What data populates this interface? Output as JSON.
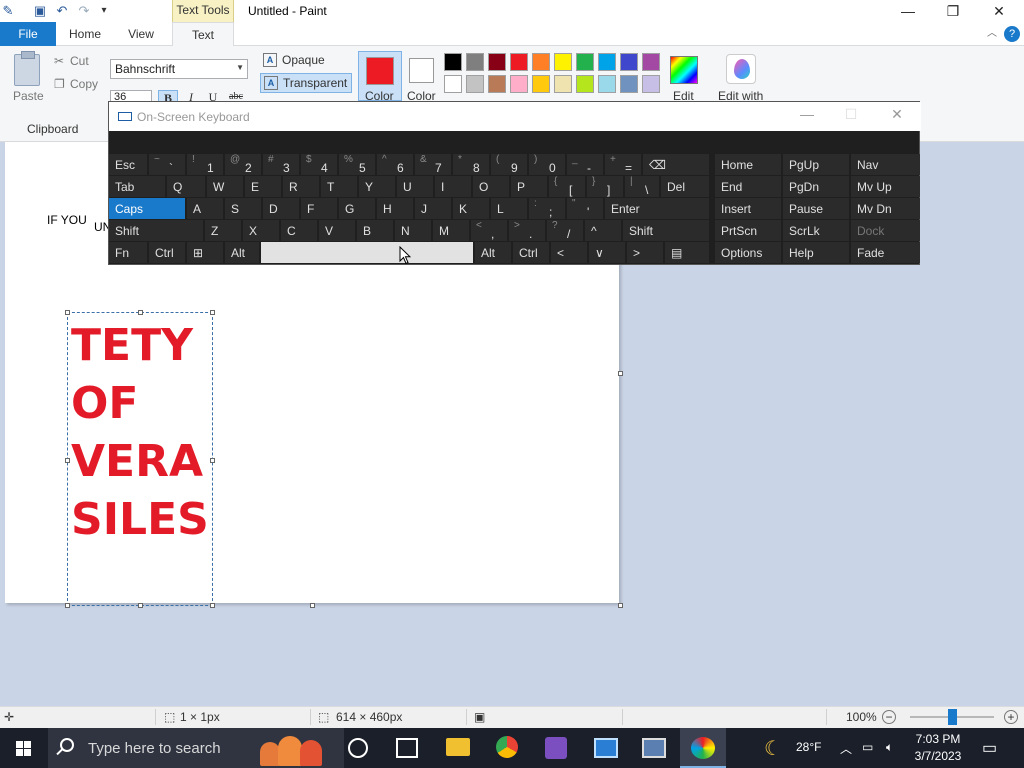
{
  "title_bar": {
    "context_tab": "Text Tools",
    "window_title": "Untitled - Paint",
    "minimize": "—",
    "maximize": "❐",
    "close": "✕"
  },
  "ribbon_tabs": {
    "file": "File",
    "home": "Home",
    "view": "View",
    "text": "Text",
    "help": "?"
  },
  "ribbon": {
    "paste": "Paste",
    "cut": "Cut",
    "copy": "Copy",
    "clipboard_group": "Clipboard",
    "font_name": "Bahnschrift",
    "font_size": "36",
    "bold": "B",
    "italic": "I",
    "underline": "U",
    "strike": "abc",
    "opaque": "Opaque",
    "transparent": "Transparent",
    "color1_label": "Color",
    "color2_label": "Color",
    "edit_colors": "Edit",
    "edit_with": "Edit with",
    "color1": "#ed1c24",
    "color2": "#ffffff",
    "palette_row1": [
      "#000000",
      "#7f7f7f",
      "#880015",
      "#ed1c24",
      "#ff7f27",
      "#fff200",
      "#22b14c",
      "#00a2e8",
      "#3f48cc",
      "#a349a4"
    ],
    "palette_row2": [
      "#ffffff",
      "#c3c3c3",
      "#b97a57",
      "#ffaec9",
      "#ffc90e",
      "#efe4b0",
      "#b5e61d",
      "#99d9ea",
      "#7092be",
      "#c8bfe7"
    ]
  },
  "canvas": {
    "text_if_you": "IF YOU",
    "text_un": "UN",
    "lines": [
      "TETY",
      "OF",
      "VERA",
      "SILES"
    ]
  },
  "osk": {
    "title": "On-Screen Keyboard",
    "rows": [
      [
        {
          "m": "Esc"
        },
        {
          "s": "~",
          "k": "`"
        },
        {
          "s": "!",
          "k": "1"
        },
        {
          "s": "@",
          "k": "2"
        },
        {
          "s": "#",
          "k": "3"
        },
        {
          "s": "$",
          "k": "4"
        },
        {
          "s": "%",
          "k": "5"
        },
        {
          "s": "^",
          "k": "6"
        },
        {
          "s": "&",
          "k": "7"
        },
        {
          "s": "*",
          "k": "8"
        },
        {
          "s": "(",
          "k": "9"
        },
        {
          "s": ")",
          "k": "0"
        },
        {
          "s": "_",
          "k": "-"
        },
        {
          "s": "+",
          "k": "="
        },
        {
          "m": "⌫"
        }
      ],
      [
        {
          "m": "Tab"
        },
        {
          "m": "Q"
        },
        {
          "m": "W"
        },
        {
          "m": "E"
        },
        {
          "m": "R"
        },
        {
          "m": "T"
        },
        {
          "m": "Y"
        },
        {
          "m": "U"
        },
        {
          "m": "I"
        },
        {
          "m": "O"
        },
        {
          "m": "P"
        },
        {
          "s": "{",
          "k": "["
        },
        {
          "s": "}",
          "k": "]"
        },
        {
          "s": "|",
          "k": "\\"
        },
        {
          "m": "Del"
        }
      ],
      [
        {
          "m": "Caps"
        },
        {
          "m": "A"
        },
        {
          "m": "S"
        },
        {
          "m": "D"
        },
        {
          "m": "F"
        },
        {
          "m": "G"
        },
        {
          "m": "H"
        },
        {
          "m": "J"
        },
        {
          "m": "K"
        },
        {
          "m": "L"
        },
        {
          "s": ":",
          "k": ";"
        },
        {
          "s": "\"",
          "k": "'"
        },
        {
          "m": "Enter"
        }
      ],
      [
        {
          "m": "Shift"
        },
        {
          "m": "Z"
        },
        {
          "m": "X"
        },
        {
          "m": "C"
        },
        {
          "m": "V"
        },
        {
          "m": "B"
        },
        {
          "m": "N"
        },
        {
          "m": "M"
        },
        {
          "s": "<",
          "k": ","
        },
        {
          "s": ">",
          "k": "."
        },
        {
          "s": "?",
          "k": "/"
        },
        {
          "m": "^"
        },
        {
          "m": "Shift"
        }
      ],
      [
        {
          "m": "Fn"
        },
        {
          "m": "Ctrl"
        },
        {
          "m": "⊞"
        },
        {
          "m": "Alt"
        },
        {
          "m": ""
        },
        {
          "m": "Alt"
        },
        {
          "m": "Ctrl"
        },
        {
          "m": "<"
        },
        {
          "m": "∨"
        },
        {
          "m": ">"
        },
        {
          "m": "▤"
        }
      ]
    ],
    "nav_rows": [
      [
        "Home",
        "PgUp",
        "Nav"
      ],
      [
        "End",
        "PgDn",
        "Mv Up"
      ],
      [
        "Insert",
        "Pause",
        "Mv Dn"
      ],
      [
        "PrtScn",
        "ScrLk",
        "Dock"
      ],
      [
        "Options",
        "Help",
        "Fade"
      ]
    ]
  },
  "status_bar": {
    "selection_size": "1 × 1px",
    "canvas_size": "614 × 460px",
    "zoom": "100%",
    "zoom_level": 0.5
  },
  "taskbar": {
    "search_placeholder": "Type here to search",
    "temperature": "28°F",
    "time": "7:03 PM",
    "date": "3/7/2023"
  }
}
